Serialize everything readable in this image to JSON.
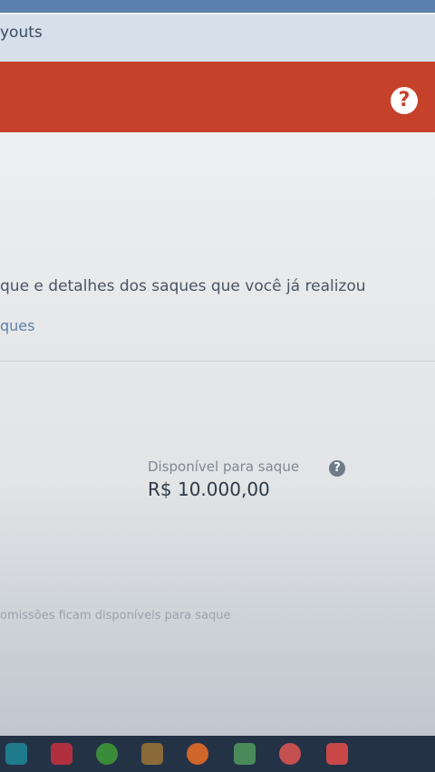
{
  "browser": {
    "tab_title": "youts"
  },
  "header": {
    "help_icon": "?"
  },
  "main": {
    "description": "que e detalhes dos saques que você já realizou",
    "tab_label": "ques",
    "balance": {
      "label": "Disponível para saque",
      "value": "R$ 10.000,00",
      "info_icon": "?"
    },
    "footnote": "omissões ficam disponíveis para saque"
  },
  "taskbar": {
    "icons": [
      "edge-icon",
      "pdf-icon",
      "chrome-icon",
      "briefcase-icon",
      "firefox-icon",
      "spreadsheet-icon",
      "browser-icon",
      "app-icon"
    ]
  },
  "colors": {
    "header_accent": "#c5412a",
    "link_blue": "#5d7fa8",
    "text_dark": "#2e3a46"
  }
}
